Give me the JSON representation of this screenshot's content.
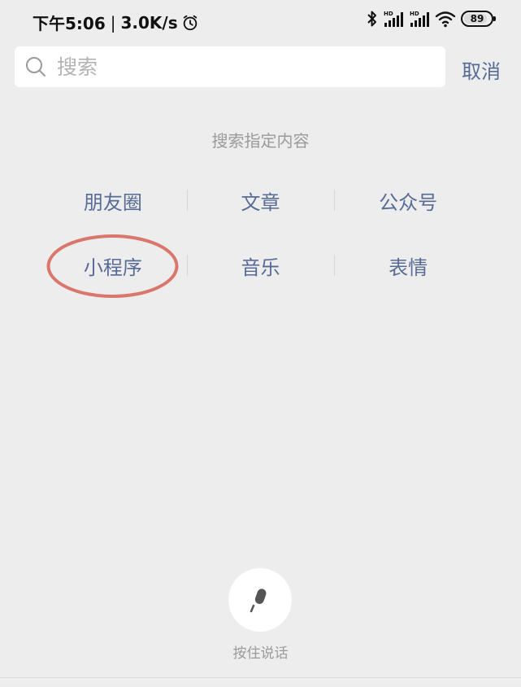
{
  "status_bar": {
    "time": "下午5:06",
    "separator": "|",
    "speed": "3.0K/s",
    "signal_label_1": "HD",
    "signal_label_2": "HD",
    "battery": "89",
    "battery_level": 0.89,
    "icons": [
      "alarm-icon",
      "bluetooth-icon",
      "signal-icon",
      "signal-icon",
      "wifi-icon",
      "battery-icon"
    ]
  },
  "search": {
    "placeholder": "搜索",
    "value": "",
    "cancel_label": "取消"
  },
  "section": {
    "title": "搜索指定内容"
  },
  "categories": [
    [
      "朋友圈",
      "文章",
      "公众号"
    ],
    [
      "小程序",
      "音乐",
      "表情"
    ]
  ],
  "annotation": {
    "color": "#d9776c",
    "target": "小程序"
  },
  "voice": {
    "label": "按住说话",
    "icon": "microphone-icon"
  },
  "colors": {
    "background": "#ededed",
    "accent": "#576b95",
    "muted": "#9b9b9b"
  }
}
